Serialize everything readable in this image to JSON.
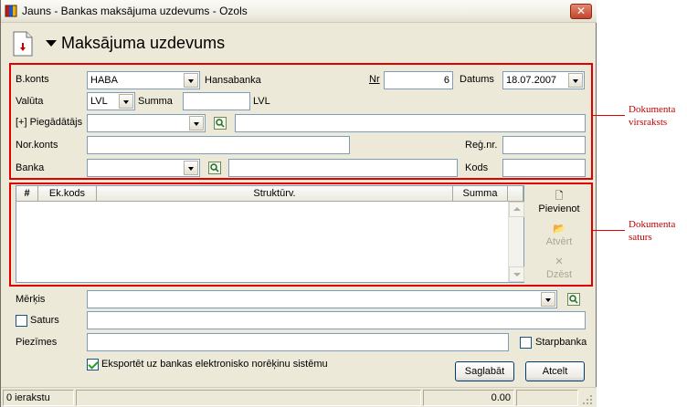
{
  "window": {
    "title": "Jauns - Bankas maksājuma uzdevums - Ozols",
    "close_label": "✕"
  },
  "header": {
    "title": "Maksājuma uzdevums"
  },
  "form": {
    "b_konts_label": "B.konts",
    "b_konts_value": "HABA",
    "bank_name_value": "Hansabanka",
    "nr_label": "Nr",
    "nr_value": "6",
    "datums_label": "Datums",
    "datums_value": "18.07.2007",
    "valuta_label": "Valūta",
    "valuta_value": "LVL",
    "summa_label": "Summa",
    "summa_value": "",
    "summa_currency": "LVL",
    "piegadatajs_label": "[+] Piegādātājs",
    "piegadatajs_value": "",
    "piegadatajs_name": "",
    "nor_konts_label": "Nor.konts",
    "nor_konts_value": "",
    "reg_nr_label": "Reģ.nr.",
    "reg_nr_value": "",
    "banka_label": "Banka",
    "banka_value": "",
    "banka_name": "",
    "kods_label": "Kods",
    "kods_value": ""
  },
  "grid": {
    "columns": [
      "#",
      "Ek.kods",
      "Struktūrv.",
      "Summa"
    ],
    "rows": []
  },
  "side_buttons": {
    "add": "Pievienot",
    "open": "Atvērt",
    "delete": "Dzēst"
  },
  "bottom": {
    "merkis_label": "Mērķis",
    "merkis_value": "",
    "saturs_label": "Saturs",
    "saturs_checked": false,
    "saturs_value": "",
    "piezimes_label": "Piezīmes",
    "piezimes_value": "",
    "starpbanka_label": "Starpbanka",
    "starpbanka_checked": false,
    "export_label": "Eksportēt uz bankas elektronisko norēķinu sistēmu",
    "export_checked": true,
    "save_label": "Saglabāt",
    "cancel_label": "Atcelt"
  },
  "status": {
    "records": "0 ierakstu",
    "total": "0.00"
  },
  "annotations": {
    "header_label": [
      "Dokumenta",
      "virsraksts"
    ],
    "content_label": [
      "Dokumenta",
      "saturs"
    ]
  },
  "colors": {
    "highlight": "#e00000",
    "window_bg": "#ece9d8"
  }
}
